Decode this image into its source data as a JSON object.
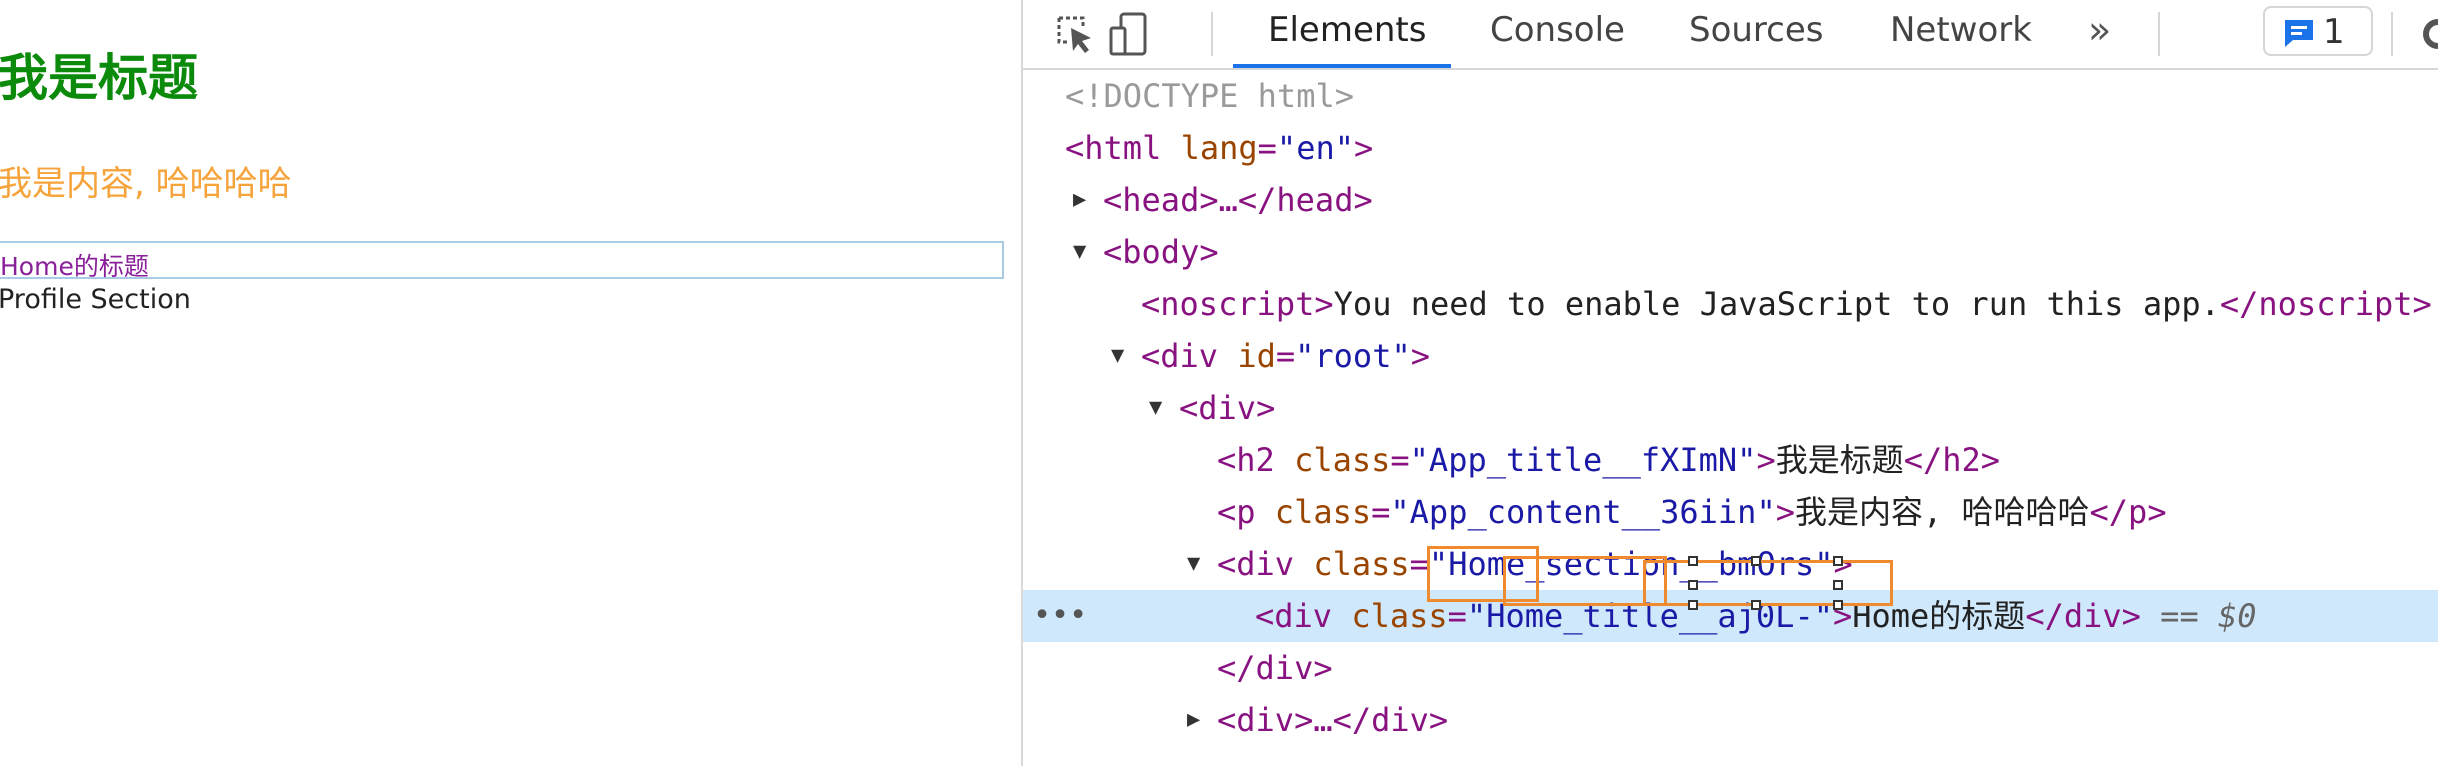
{
  "page": {
    "title": "我是标题",
    "content": "我是内容, 哈哈哈哈",
    "home_title": "Home的标题",
    "profile_section": "Profile Section"
  },
  "devtools": {
    "tabs": [
      {
        "label": "Elements",
        "active": true
      },
      {
        "label": "Console",
        "active": false
      },
      {
        "label": "Sources",
        "active": false
      },
      {
        "label": "Network",
        "active": false
      }
    ],
    "more_tabs": "»",
    "issues_count": "1",
    "tree": {
      "doctype": "<!DOCTYPE html>",
      "html_open": "<html",
      "html_attr": "lang",
      "html_value": "\"en\"",
      "head_tag": "<head>…</head>",
      "body_tag": "<body>",
      "noscript_open": "<noscript>",
      "noscript_text": "You need to enable JavaScript to run this app.",
      "noscript_close": "</noscript>",
      "div_root_open": "<div",
      "div_root_attr": "id",
      "div_root_value": "\"root\"",
      "div_tag": "<div>",
      "h2_open": "<h2",
      "h2_attr": "class",
      "h2_value": "\"App_title__fXImN\"",
      "h2_text": "我是标题",
      "h2_close": "</h2>",
      "p_open": "<p",
      "p_attr": "class",
      "p_value": "\"App_content__36iin\"",
      "p_text": "我是内容, 哈哈哈哈",
      "p_close": "</p>",
      "sec_open": "<div",
      "sec_attr": "class",
      "sec_value": "\"Home_section__bmOrs\"",
      "sel_open": "<div",
      "sel_attr": "class",
      "sel_value": "\"Home_title__aj0L-\"",
      "sel_text": "Home的标题",
      "sel_close": "</div>",
      "sel_marker": "== $0",
      "div_close": "</div>",
      "div_collapsed": "<div>…</div>",
      "ellipsis": "•••"
    },
    "colors": {
      "accent": "#1a73e8",
      "selection": "#cfe8fc",
      "highlight": "#f08a2e",
      "title_green": "#0b8a0b",
      "content_orange": "#f5a33a",
      "home_purple": "#8a1f9a"
    },
    "icons": [
      "inspect-icon",
      "device-toolbar-icon",
      "issues-icon",
      "settings-icon"
    ]
  }
}
